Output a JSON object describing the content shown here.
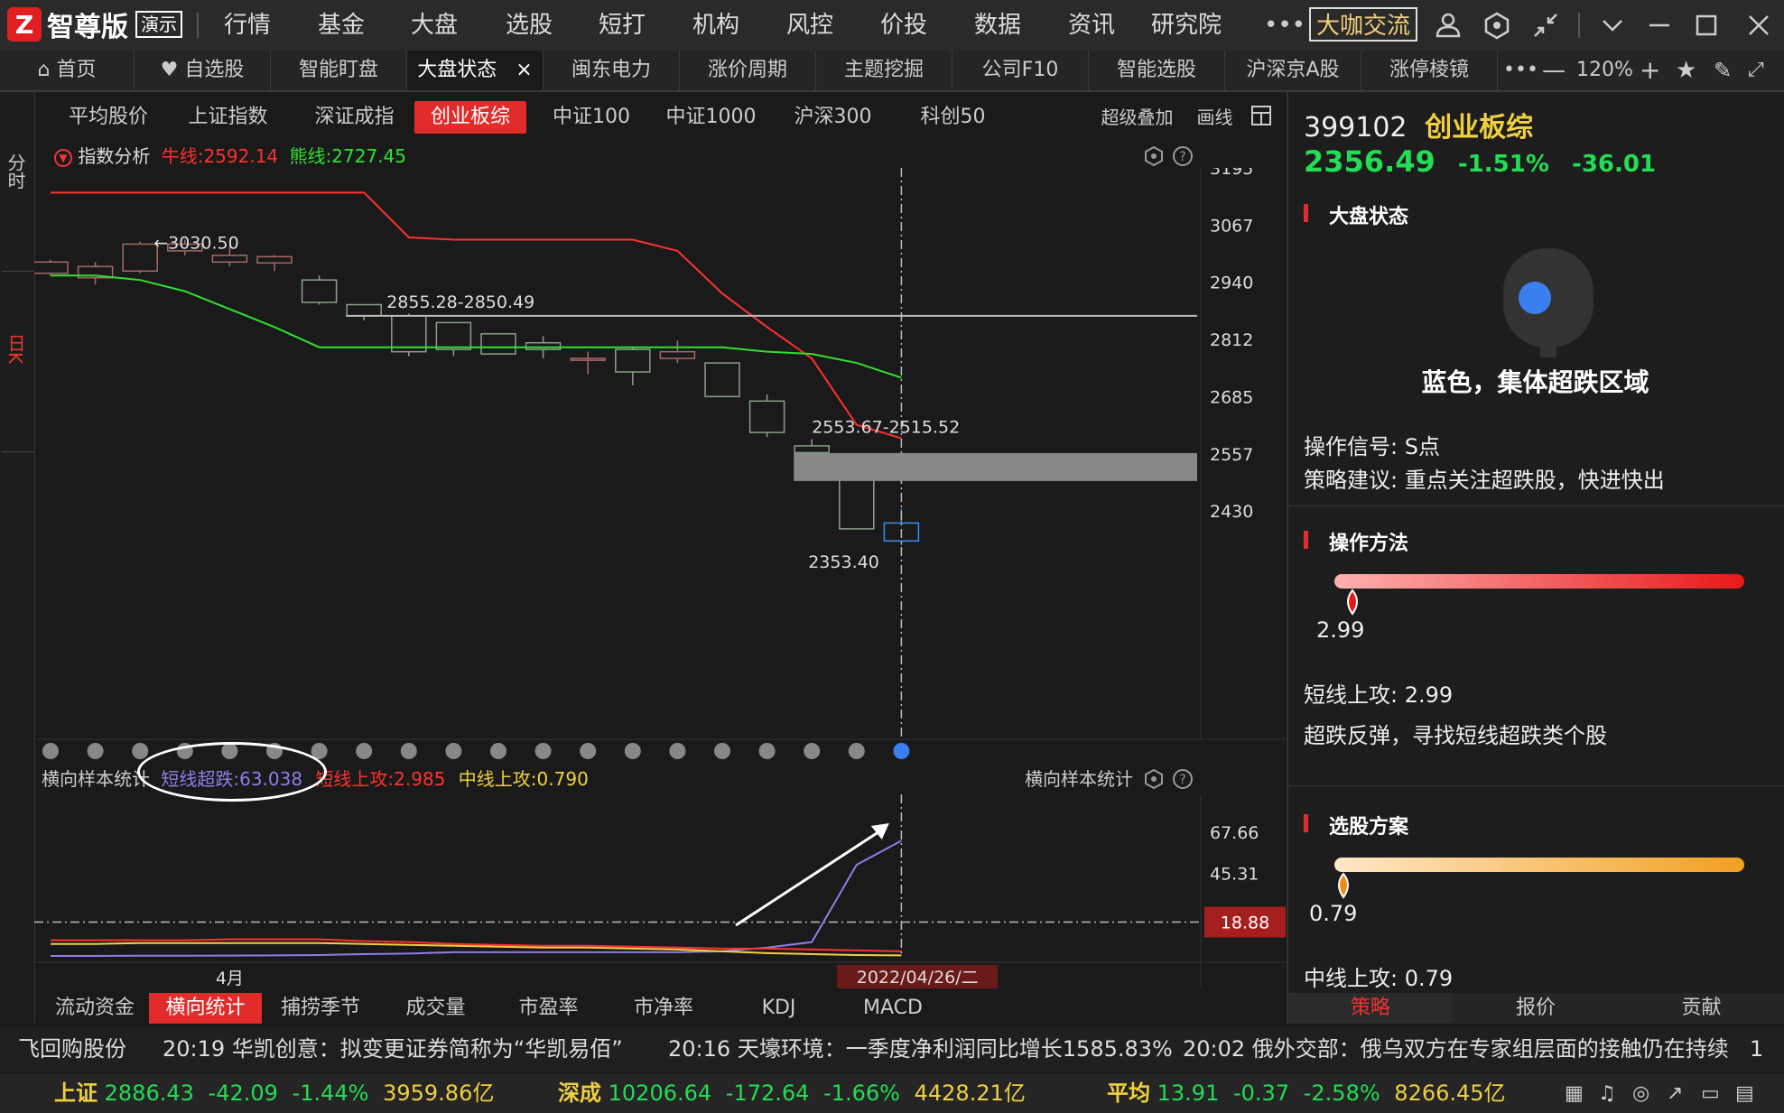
{
  "app": {
    "logo_mark": "Z",
    "logo_name": "智尊版",
    "demo": "演示"
  },
  "menu": [
    "行情",
    "基金",
    "大盘",
    "选股",
    "短打",
    "机构",
    "风控",
    "价投",
    "数据",
    "资讯",
    "研究院"
  ],
  "daka_button": "大咖交流",
  "tabs": [
    {
      "label": "首页",
      "icon": "home-icon"
    },
    {
      "label": "自选股",
      "icon": "heart-icon"
    },
    {
      "label": "智能盯盘"
    },
    {
      "label": "大盘状态",
      "active": true
    },
    {
      "label": "闽东电力"
    },
    {
      "label": "涨价周期"
    },
    {
      "label": "主题挖掘"
    },
    {
      "label": "公司F10"
    },
    {
      "label": "智能选股"
    },
    {
      "label": "沪深京A股"
    },
    {
      "label": "涨停棱镜"
    }
  ],
  "zoom": "120%",
  "index_tabs": [
    "平均股价",
    "上证指数",
    "深证成指",
    "创业板综",
    "中证100",
    "中证1000",
    "沪深300",
    "科创50"
  ],
  "active_index_tab": "创业板综",
  "chart_tools": {
    "overlay": "超级叠加",
    "draw": "画线"
  },
  "left_strip": {
    "fenshi": "分时",
    "rik": "日K"
  },
  "main_chart_header": {
    "label": "指数分析",
    "bull": "牛线:2592.14",
    "bear": "熊线:2727.45",
    "bull_color": "#ff3030",
    "bear_color": "#30e030"
  },
  "annotations": {
    "high": "←3030.50",
    "range1": "2855.28-2850.49",
    "range2": "2553.67-2515.52",
    "low": "2353.40"
  },
  "sub_chart_header": {
    "label": "横向样本统计",
    "short_oversold": "短线超跌:63.038",
    "short_up": "短线上攻:2.985",
    "mid_up": "中线上攻:0.790",
    "right_label": "横向样本统计"
  },
  "date_label": "4月",
  "cursor_date": "2022/04/26/二",
  "chart_data": [
    {
      "type": "candlestick",
      "title": "",
      "y_ticks": [
        3195,
        3067,
        2940,
        2812,
        2685,
        2557,
        2430
      ],
      "candles": [
        {
          "o": 2960,
          "c": 2985,
          "h": 2990,
          "l": 2955
        },
        {
          "o": 2950,
          "c": 2975,
          "h": 2985,
          "l": 2935
        },
        {
          "o": 2965,
          "c": 3025,
          "h": 3030.5,
          "l": 2960
        },
        {
          "o": 3010,
          "c": 3025,
          "h": 3035,
          "l": 3000
        },
        {
          "o": 2985,
          "c": 3000,
          "h": 3020,
          "l": 2975
        },
        {
          "o": 2983,
          "c": 2997,
          "h": 3000,
          "l": 2965
        },
        {
          "o": 2945,
          "c": 2895,
          "h": 2955,
          "l": 2890
        },
        {
          "o": 2890,
          "c": 2865,
          "h": 2875,
          "l": 2855
        },
        {
          "o": 2865,
          "c": 2785,
          "h": 2870,
          "l": 2775
        },
        {
          "o": 2850,
          "c": 2790,
          "h": 2850,
          "l": 2775
        },
        {
          "o": 2825,
          "c": 2780,
          "h": 2825,
          "l": 2780
        },
        {
          "o": 2805,
          "c": 2790,
          "h": 2820,
          "l": 2770
        },
        {
          "o": 2770,
          "c": 2770,
          "h": 2785,
          "l": 2735
        },
        {
          "o": 2790,
          "c": 2740,
          "h": 2795,
          "l": 2710
        },
        {
          "o": 2770,
          "c": 2785,
          "h": 2810,
          "l": 2760
        },
        {
          "o": 2760,
          "c": 2685,
          "h": 2760,
          "l": 2685
        },
        {
          "o": 2675,
          "c": 2605,
          "h": 2690,
          "l": 2595
        },
        {
          "o": 2575,
          "c": 2560,
          "h": 2590,
          "l": 2555
        },
        {
          "o": 2510,
          "c": 2390,
          "h": 2515,
          "l": 2390
        },
        {
          "o": 2403,
          "c": 2363,
          "h": 2435,
          "l": 2353.4
        }
      ],
      "bull_line": [
        3140,
        3140,
        3140,
        3140,
        3140,
        3140,
        3140,
        3140,
        3040,
        3035,
        3035,
        3035,
        3035,
        3035,
        3010,
        2915,
        2840,
        2770,
        2622,
        2592
      ],
      "bear_line": [
        2955,
        2955,
        2945,
        2920,
        2880,
        2840,
        2795,
        2795,
        2795,
        2795,
        2795,
        2795,
        2795,
        2795,
        2795,
        2795,
        2785,
        2780,
        2760,
        2727
      ]
    },
    {
      "type": "line",
      "title": "",
      "y_ticks": [
        67.66,
        45.31,
        18.88
      ],
      "series": [
        {
          "name": "短线超跌",
          "color": "#8a7ee8",
          "values": [
            0.5,
            0.5,
            0.6,
            0.6,
            0.7,
            0.8,
            1,
            1.5,
            1.8,
            2.5,
            2.5,
            2.5,
            2.5,
            2.5,
            2.5,
            3,
            5,
            8,
            50,
            63.038
          ]
        },
        {
          "name": "短线上攻",
          "color": "#ff3030",
          "values": [
            9,
            9,
            9,
            9,
            9.5,
            9.5,
            9.5,
            8.5,
            8,
            7,
            6.5,
            6,
            6,
            5.5,
            5,
            4.5,
            4.5,
            4,
            3.5,
            2.985
          ]
        },
        {
          "name": "中线上攻",
          "color": "#f0d040",
          "values": [
            7,
            7,
            7.5,
            7.5,
            7.5,
            7.5,
            7.5,
            7,
            6.5,
            6,
            5.5,
            5,
            5,
            4.5,
            4,
            3,
            2,
            1.5,
            1,
            0.79
          ]
        }
      ]
    }
  ],
  "bottom_tabs": [
    "流动资金",
    "横向统计",
    "捕捞季节",
    "成交量",
    "市盈率",
    "市净率",
    "KDJ",
    "MACD"
  ],
  "active_bottom_tab": "横向统计",
  "quote": {
    "code": "399102",
    "name": "创业板综",
    "price": "2356.49",
    "pct": "-1.51%",
    "chg": "-36.01"
  },
  "market_state": {
    "section": "大盘状态",
    "light_color": "#3a7ff0",
    "state_text": "蓝色，集体超跌区域",
    "signal": "操作信号: S点",
    "advice": "策略建议: 重点关注超跌股，快进快出"
  },
  "method": {
    "section": "操作方法",
    "value": "2.99",
    "position": 0.03,
    "label": "短线上攻:",
    "label_value": "2.99",
    "desc": "超跌反弹，寻找短线超跌类个股"
  },
  "stock_plan": {
    "section": "选股方案",
    "value": "0.79",
    "position": 0.01,
    "label": "中线上攻:",
    "label_value": "0.79"
  },
  "right_tabs": [
    "策略",
    "报价",
    "贡献"
  ],
  "active_right_tab": "策略",
  "ticker": [
    "飞回购股份",
    "20:19 华凯创意：拟变更证券简称为“华凯易佰”",
    "20:16 天壕环境：一季度净利润同比增长1585.83%",
    "20:02 俄外交部：俄乌双方在专家组层面的接触仍在持续",
    "1"
  ],
  "indices": [
    {
      "name": "上证",
      "price": "2886.43",
      "chg": "-42.09",
      "pct": "-1.44%",
      "amount": "3959.86亿"
    },
    {
      "name": "深成",
      "price": "10206.64",
      "chg": "-172.64",
      "pct": "-1.66%",
      "amount": "4428.21亿"
    },
    {
      "name": "平均",
      "price": "13.91",
      "chg": "-0.37",
      "pct": "-2.58%",
      "amount": "8266.45亿"
    }
  ]
}
